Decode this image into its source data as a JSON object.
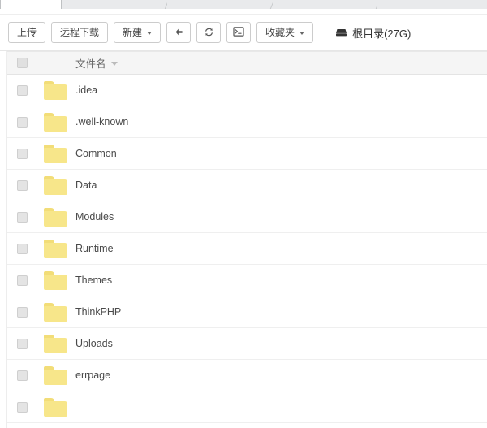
{
  "browser": {
    "tabs": [
      {
        "state": "active",
        "label": ""
      },
      {
        "state": "inactive",
        "label": ""
      },
      {
        "state": "inactive",
        "label": ""
      },
      {
        "state": "inactive",
        "label": ""
      }
    ]
  },
  "toolbar": {
    "upload_label": "上传",
    "remote_download_label": "远程下载",
    "new_label": "新建",
    "back_icon": "arrow-left-icon",
    "refresh_icon": "refresh-icon",
    "terminal_icon": "terminal-icon",
    "favorites_label": "收藏夹",
    "root": {
      "icon": "hard-disk-icon",
      "label": "根目录(27G)"
    }
  },
  "table": {
    "header": {
      "select_all": "",
      "name_column": "文件名",
      "sort_icon": "caret-down-icon"
    },
    "rows": [
      {
        "name": ".idea",
        "type": "folder"
      },
      {
        "name": ".well-known",
        "type": "folder"
      },
      {
        "name": "Common",
        "type": "folder"
      },
      {
        "name": "Data",
        "type": "folder"
      },
      {
        "name": "Modules",
        "type": "folder"
      },
      {
        "name": "Runtime",
        "type": "folder"
      },
      {
        "name": "Themes",
        "type": "folder"
      },
      {
        "name": "ThinkPHP",
        "type": "folder"
      },
      {
        "name": "Uploads",
        "type": "folder"
      },
      {
        "name": "errpage",
        "type": "folder"
      },
      {
        "name": "",
        "type": "folder"
      }
    ]
  },
  "colors": {
    "folder_body": "#f7e68a",
    "folder_tab": "#f2dd78",
    "header_bg": "#f5f5f5",
    "row_border": "#efefef",
    "button_border": "#cccccc",
    "text": "#4a4a4a"
  }
}
